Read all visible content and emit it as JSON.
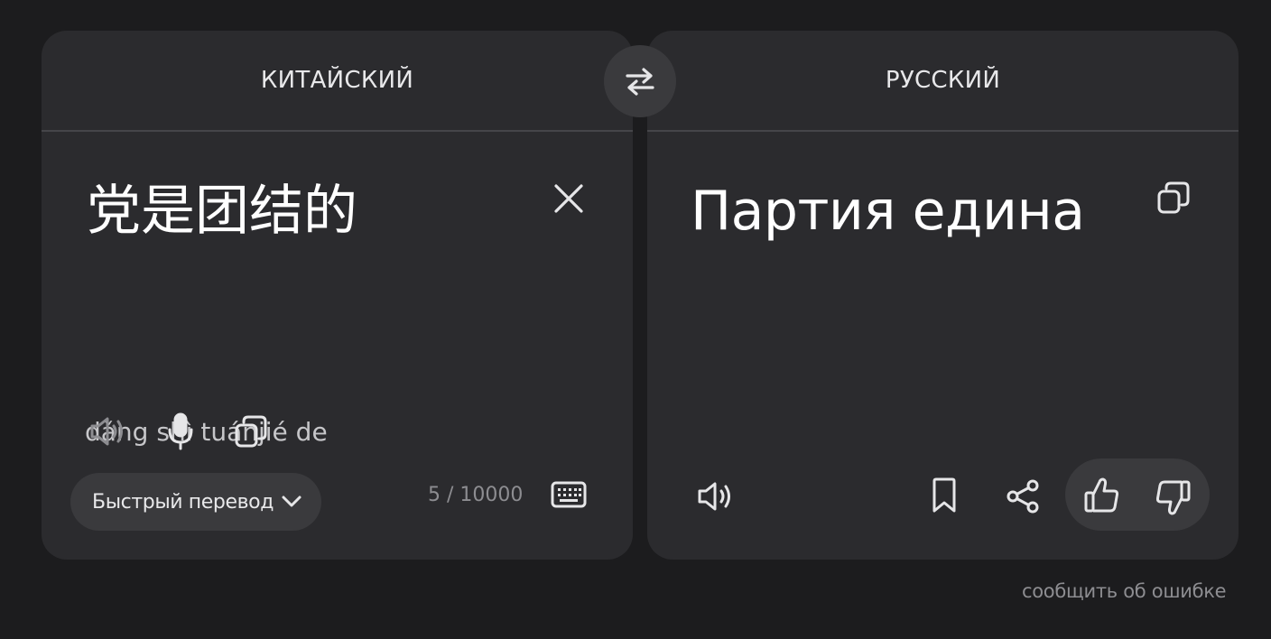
{
  "source": {
    "language": "КИТАЙСКИЙ",
    "text": "党是团结的",
    "transliteration": "dǎng shì tuánjié de",
    "quick_translate_label": "Быстрый перевод",
    "char_count": "5 / 10000"
  },
  "target": {
    "language": "РУССКИЙ",
    "text": "Партия едина"
  },
  "footer": {
    "report_error_label": "сообщить об ошибке"
  },
  "colors": {
    "background": "#1c1c1e",
    "panel": "#2b2b2e",
    "button_bg": "#3a3a3d",
    "muted_text": "#8d8d91"
  },
  "icons": {
    "swap": "swap-arrows-icon",
    "clear": "close-icon",
    "speaker": "speaker-icon",
    "microphone": "microphone-icon",
    "copy": "copy-icon",
    "keyboard": "keyboard-icon",
    "bookmark": "bookmark-icon",
    "share": "share-icon",
    "like": "thumbs-up-icon",
    "dislike": "thumbs-down-icon",
    "dropdown": "chevron-down-icon"
  }
}
